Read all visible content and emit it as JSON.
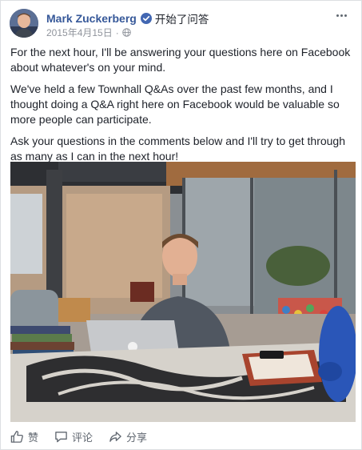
{
  "post": {
    "author": "Mark Zuckerberg",
    "action": "开始了问答",
    "date": "2015年4月15日",
    "meta_separator": "·",
    "paragraphs": [
      "For the next hour, I'll be answering your questions here on Facebook about whatever's on your mind.",
      "We've held a few Townhall Q&As over the past few months, and I thought doing a Q&A right here on Facebook would be valuable so more people can participate.",
      "Ask your questions in the comments below and I'll try to get through as many as I can in the next hour!"
    ]
  },
  "actions": {
    "like": "赞",
    "comment": "评论",
    "share": "分享"
  },
  "icons": {
    "verified": "verified-badge-icon",
    "privacy": "globe-icon",
    "menu": "more-options-icon",
    "like": "thumbs-up-icon",
    "comment": "comment-bubble-icon",
    "share": "share-arrow-icon"
  },
  "colors": {
    "author_link": "#365899",
    "verified_badge": "#4267b2",
    "meta_text": "#90949c",
    "action_text": "#606770"
  }
}
